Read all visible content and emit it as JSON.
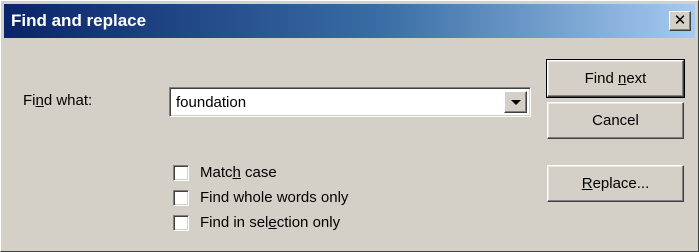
{
  "window": {
    "title": "Find and replace",
    "close_glyph": "✕"
  },
  "find": {
    "label_pre": "Fi",
    "label_key": "n",
    "label_post": "d what:",
    "value": "foundation"
  },
  "buttons": {
    "find_next_pre": "Find ",
    "find_next_key": "n",
    "find_next_post": "ext",
    "cancel": "Cancel",
    "replace_key": "R",
    "replace_post": "eplace..."
  },
  "options": {
    "match_case_pre": "Matc",
    "match_case_key": "h",
    "match_case_post": " case",
    "match_case_checked": false,
    "whole_words": "Find whole words only",
    "whole_words_checked": false,
    "selection_pre": "Find in sel",
    "selection_key": "e",
    "selection_post": "ction only",
    "selection_checked": false
  }
}
